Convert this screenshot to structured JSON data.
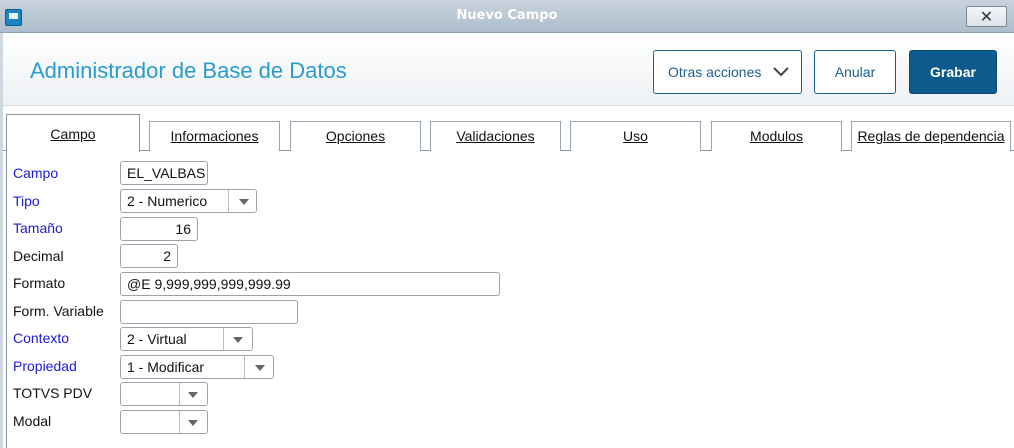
{
  "window": {
    "title": "Nuevo Campo",
    "close_icon": "close-icon",
    "app_icon": "app-window-icon"
  },
  "header": {
    "title": "Administrador de Base de Datos",
    "more_actions_label": "Otras acciones",
    "cancel_label": "Anular",
    "save_label": "Grabar",
    "colors": {
      "title": "#2a9bd0",
      "primary_button": "#0d5a8c",
      "outline": "#1e5f8e"
    }
  },
  "tabs": [
    {
      "label": "Campo",
      "active": true
    },
    {
      "label": "Informaciones",
      "active": false
    },
    {
      "label": "Opciones",
      "active": false
    },
    {
      "label": "Validaciones",
      "active": false
    },
    {
      "label": "Uso",
      "active": false
    },
    {
      "label": "Modulos",
      "active": false
    },
    {
      "label": "Reglas de dependencia",
      "active": false
    }
  ],
  "form": {
    "campo": {
      "label": "Campo",
      "value": "EL_VALBAS"
    },
    "tipo": {
      "label": "Tipo",
      "value": "2 - Numerico"
    },
    "tamano": {
      "label": "Tamaño",
      "value": "16"
    },
    "decimal": {
      "label": "Decimal",
      "value": "2"
    },
    "formato": {
      "label": "Formato",
      "value": "@E 9,999,999,999,999.99"
    },
    "form_variable": {
      "label": "Form. Variable",
      "value": ""
    },
    "contexto": {
      "label": "Contexto",
      "value": "2 - Virtual"
    },
    "propiedad": {
      "label": "Propiedad",
      "value": "1 - Modificar"
    },
    "totvs_pdv": {
      "label": "TOTVS PDV",
      "value": ""
    },
    "modal": {
      "label": "Modal",
      "value": ""
    }
  },
  "colors": {
    "required_label": "#1a1ad4",
    "label": "#111111"
  }
}
